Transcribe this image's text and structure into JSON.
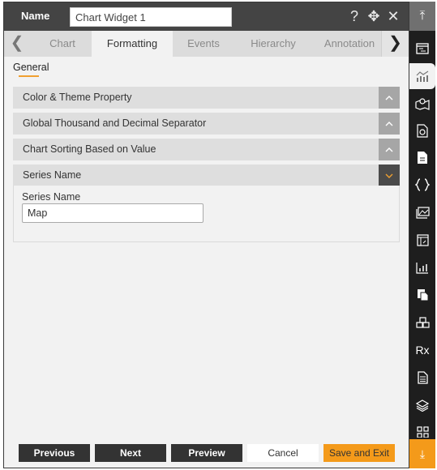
{
  "header": {
    "name_label": "Name",
    "name_value": "Chart Widget 1",
    "icons": [
      "help-icon",
      "move-icon",
      "close-icon"
    ],
    "help_glyph": "?",
    "move_glyph": "✥",
    "close_glyph": "✕"
  },
  "tabs": {
    "prev_glyph": "❮",
    "next_glyph": "❯",
    "items": [
      {
        "label": "Chart",
        "active": false
      },
      {
        "label": "Formatting",
        "active": true
      },
      {
        "label": "Events",
        "active": false
      },
      {
        "label": "Hierarchy",
        "active": false
      },
      {
        "label": "Annotation",
        "active": false
      }
    ]
  },
  "subtab": {
    "label": "General"
  },
  "accordions": [
    {
      "label": "Color & Theme Property",
      "expanded": false
    },
    {
      "label": "Global Thousand and Decimal Separator",
      "expanded": false
    },
    {
      "label": "Chart Sorting Based on Value",
      "expanded": false
    },
    {
      "label": "Series Name",
      "expanded": true
    }
  ],
  "accordion_glyphs": {
    "collapsed": "^",
    "expanded": "⌄"
  },
  "series_name": {
    "field_label": "Series Name",
    "value": "Map"
  },
  "footer": {
    "previous": "Previous",
    "next": "Next",
    "preview": "Preview",
    "cancel": "Cancel",
    "save_exit": "Save and Exit"
  },
  "sidebar": {
    "top_glyph": "⤒",
    "bottom_glyph": "⤓",
    "items": [
      {
        "icon": "widget-properties-icon",
        "active": false
      },
      {
        "icon": "chart-icon",
        "active": true
      },
      {
        "icon": "map-icon",
        "active": false
      },
      {
        "icon": "document-chart-icon",
        "active": false
      },
      {
        "icon": "document-icon",
        "active": false
      },
      {
        "icon": "code-braces-icon",
        "active": false
      },
      {
        "icon": "image-icon",
        "active": false
      },
      {
        "icon": "table-icon",
        "active": false
      },
      {
        "icon": "bar-chart-icon",
        "active": false
      },
      {
        "icon": "copy-icon",
        "active": false
      },
      {
        "icon": "cubes-icon",
        "active": false
      },
      {
        "icon": "rx-icon",
        "active": false
      },
      {
        "icon": "report-icon",
        "active": false
      },
      {
        "icon": "layers-icon",
        "active": false
      },
      {
        "icon": "grid-icon",
        "active": false
      }
    ],
    "rx_text": "Rx"
  },
  "colors": {
    "accent": "#f49a1a",
    "header_bg": "#444444",
    "sidebar_bg": "#1e1e1e"
  }
}
